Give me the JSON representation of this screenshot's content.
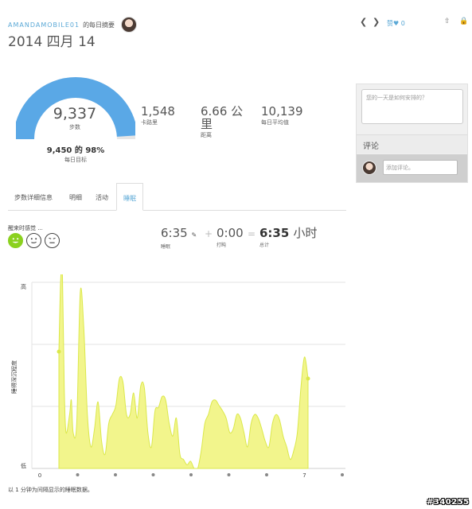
{
  "header": {
    "username": "AMANDAMOBILE01",
    "summary_label": "的每日摘要",
    "date": "2014 四月 14",
    "like_label": "赞",
    "like_count": "0"
  },
  "steps": {
    "value": "9,337",
    "label": "步数",
    "goal_text": "9,450 的 98%",
    "goal_label": "每日目标",
    "progress": 0.98
  },
  "stats": {
    "calories": {
      "value": "1,548",
      "label": "卡路里"
    },
    "distance": {
      "value": "6.66 公里",
      "label": "距离"
    },
    "daily_avg": {
      "value": "10,139",
      "label": "每日平均值"
    }
  },
  "side": {
    "plan_placeholder": "您的一天是如何安排的？",
    "comments_title": "评论",
    "comment_placeholder": "添加评论。"
  },
  "tabs": [
    {
      "label": "步数详细信息"
    },
    {
      "label": "明细"
    },
    {
      "label": "活动"
    },
    {
      "label": "睡眠"
    }
  ],
  "sleep": {
    "feel_label": "醒来时感觉 ...",
    "sleep_time": "6:35",
    "sleep_label": "睡眠",
    "snooze_time": "0:00",
    "snooze_label": "打盹",
    "total_time": "6:35",
    "total_unit": "小时",
    "total_label": "总计",
    "plus": "+",
    "equals": "="
  },
  "chart_data": {
    "type": "area",
    "ylabel": "睡得深沉程度",
    "y_high_label": "高",
    "y_low_label": "低",
    "x_tick_labels": [
      "0",
      "7"
    ],
    "x": [
      0,
      0.05,
      0.1,
      0.15,
      0.2,
      0.3,
      0.35,
      0.4,
      0.5,
      0.6,
      0.7,
      0.8,
      0.9,
      1.0,
      1.1,
      1.2,
      1.3,
      1.4,
      1.5,
      1.6,
      1.7,
      1.8,
      1.9,
      2.0,
      2.1,
      2.2,
      2.3,
      2.4,
      2.5,
      2.6,
      2.7,
      2.8,
      2.9,
      3.0,
      3.1,
      3.2,
      3.3,
      3.4,
      3.5,
      3.6,
      3.7,
      3.8,
      3.9,
      4.0,
      4.1,
      4.2,
      4.3,
      4.4,
      4.5,
      4.6,
      4.7,
      4.8,
      4.9,
      5.0,
      5.1,
      5.2,
      5.3,
      5.4,
      5.5,
      5.6,
      5.7,
      5.8,
      5.9,
      6.0,
      6.1,
      6.2,
      6.3,
      6.4,
      6.5,
      6.6,
      6.7,
      6.8,
      6.9,
      7.0
    ],
    "values": [
      0.65,
      1.05,
      1.1,
      0.45,
      0.2,
      0.3,
      0.38,
      0.2,
      0.25,
      0.98,
      0.78,
      0.3,
      0.12,
      0.22,
      0.37,
      0.15,
      0.08,
      0.25,
      0.3,
      0.35,
      0.5,
      0.48,
      0.3,
      0.3,
      0.42,
      0.28,
      0.46,
      0.45,
      0.2,
      0.12,
      0.32,
      0.34,
      0.4,
      0.38,
      0.25,
      0.18,
      0.28,
      0.08,
      0.05,
      0.02,
      0.04,
      0.0,
      0.0,
      0.1,
      0.25,
      0.3,
      0.37,
      0.38,
      0.35,
      0.32,
      0.28,
      0.2,
      0.22,
      0.3,
      0.28,
      0.2,
      0.12,
      0.25,
      0.3,
      0.28,
      0.22,
      0.15,
      0.12,
      0.25,
      0.3,
      0.27,
      0.18,
      0.12,
      0.05,
      0.1,
      0.2,
      0.45,
      0.62,
      0.5
    ],
    "ylim": [
      0,
      1
    ],
    "grid": true,
    "fill_color": "#f2f58c",
    "line_color": "#dbe84b"
  }
}
